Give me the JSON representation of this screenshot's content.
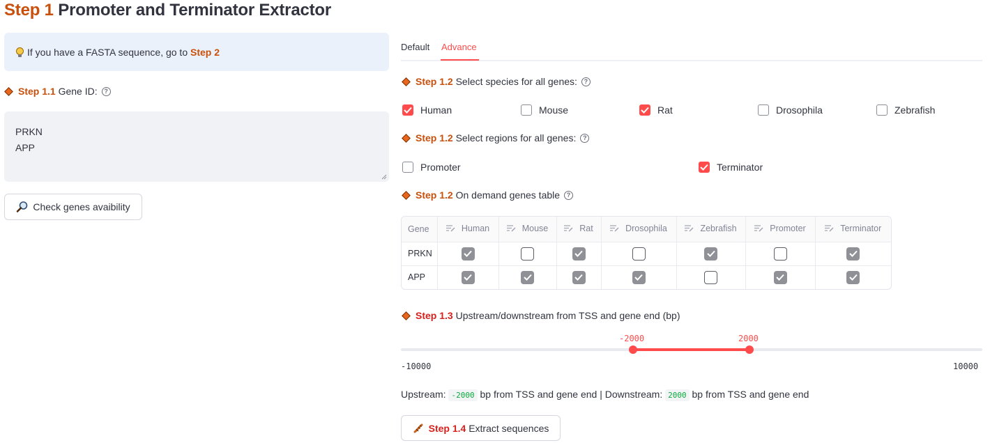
{
  "title": {
    "step": "Step 1",
    "text": "Promoter and Terminator Extractor"
  },
  "info": {
    "text": "If you have a FASTA sequence, go to",
    "link": "Step 2"
  },
  "gene_id": {
    "step": "Step 1.1",
    "label": "Gene ID:"
  },
  "gene_input": {
    "lines": [
      "PRKN",
      "APP"
    ]
  },
  "check_button": {
    "label": "Check genes avaibility"
  },
  "tabs": [
    {
      "label": "Default",
      "active": false
    },
    {
      "label": "Advance",
      "active": true
    }
  ],
  "species": {
    "step": "Step 1.2",
    "label": "Select species for all genes:",
    "options": [
      {
        "label": "Human",
        "checked": true
      },
      {
        "label": "Mouse",
        "checked": false
      },
      {
        "label": "Rat",
        "checked": true
      },
      {
        "label": "Drosophila",
        "checked": false
      },
      {
        "label": "Zebrafish",
        "checked": false
      }
    ]
  },
  "regions": {
    "step": "Step 1.2",
    "label": "Select regions for all genes:",
    "options": [
      {
        "label": "Promoter",
        "checked": false
      },
      {
        "label": "Terminator",
        "checked": true
      }
    ]
  },
  "genes_table": {
    "step": "Step 1.2",
    "label": "On demand genes table",
    "columns": [
      "Gene",
      "Human",
      "Mouse",
      "Rat",
      "Drosophila",
      "Zebrafish",
      "Promoter",
      "Terminator"
    ],
    "rows": [
      {
        "gene": "PRKN",
        "values": [
          true,
          false,
          true,
          false,
          true,
          false,
          true
        ]
      },
      {
        "gene": "APP",
        "values": [
          true,
          true,
          true,
          true,
          false,
          true,
          true
        ]
      }
    ]
  },
  "range": {
    "step": "Step 1.3",
    "label": "Upstream/downstream from TSS and gene end (bp)",
    "min_label": "-10000",
    "max_label": "10000",
    "low_label": "-2000",
    "high_label": "2000",
    "min": -10000,
    "max": 10000,
    "low": -2000,
    "high": 2000
  },
  "summary": {
    "upstream_label": "Upstream:",
    "upstream_value": "-2000",
    "mid_text": "bp from TSS and gene end | Downstream:",
    "downstream_value": "2000",
    "end_text": "bp from TSS and gene end"
  },
  "extract_button": {
    "step": "Step 1.4",
    "label": "Extract sequences"
  },
  "colors": {
    "accent": "#ff4b4b",
    "step_orange": "#c8500c",
    "step_red": "#d8201c"
  }
}
